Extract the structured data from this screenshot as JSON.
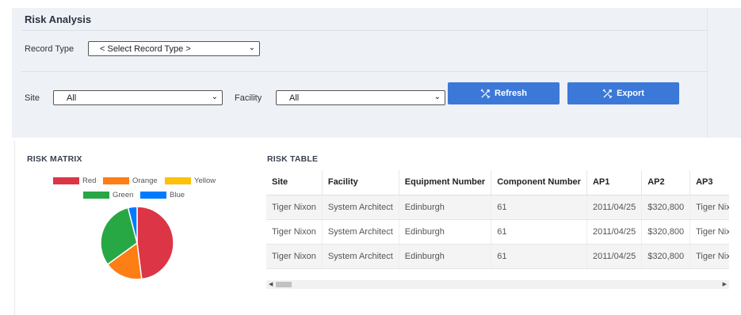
{
  "panel": {
    "title": "Risk Analysis"
  },
  "filters": {
    "record_type_label": "Record Type",
    "record_type_value": "< Select Record Type >",
    "site_label": "Site",
    "site_value": "All",
    "facility_label": "Facility",
    "facility_value": "All"
  },
  "buttons": {
    "refresh": "Refresh",
    "export": "Export"
  },
  "colors": {
    "accent": "#3c78d8",
    "panel_bg": "#eef1f6"
  },
  "risk_matrix": {
    "title": "RISK MATRIX",
    "legend": [
      {
        "label": "Red",
        "color": "#dc3545"
      },
      {
        "label": "Orange",
        "color": "#fd7e14"
      },
      {
        "label": "Yellow",
        "color": "#ffc107"
      },
      {
        "label": "Green",
        "color": "#28a745"
      },
      {
        "label": "Blue",
        "color": "#007bff"
      }
    ]
  },
  "chart_data": {
    "type": "pie",
    "categories": [
      "Red",
      "Orange",
      "Yellow",
      "Green",
      "Blue"
    ],
    "values": [
      48,
      17,
      0,
      31,
      4
    ],
    "colors": [
      "#dc3545",
      "#fd7e14",
      "#ffc107",
      "#28a745",
      "#007bff"
    ],
    "legend_position": "top"
  },
  "risk_table": {
    "title": "RISK TABLE",
    "columns": [
      "Site",
      "Facility",
      "Equipment Number",
      "Component Number",
      "AP1",
      "AP2",
      "AP3"
    ],
    "rows": [
      [
        "Tiger Nixon",
        "System Architect",
        "Edinburgh",
        "61",
        "2011/04/25",
        "$320,800",
        "Tiger Nixon"
      ],
      [
        "Tiger Nixon",
        "System Architect",
        "Edinburgh",
        "61",
        "2011/04/25",
        "$320,800",
        "Tiger Nixon"
      ],
      [
        "Tiger Nixon",
        "System Architect",
        "Edinburgh",
        "61",
        "2011/04/25",
        "$320,800",
        "Tiger Nixon"
      ]
    ]
  }
}
